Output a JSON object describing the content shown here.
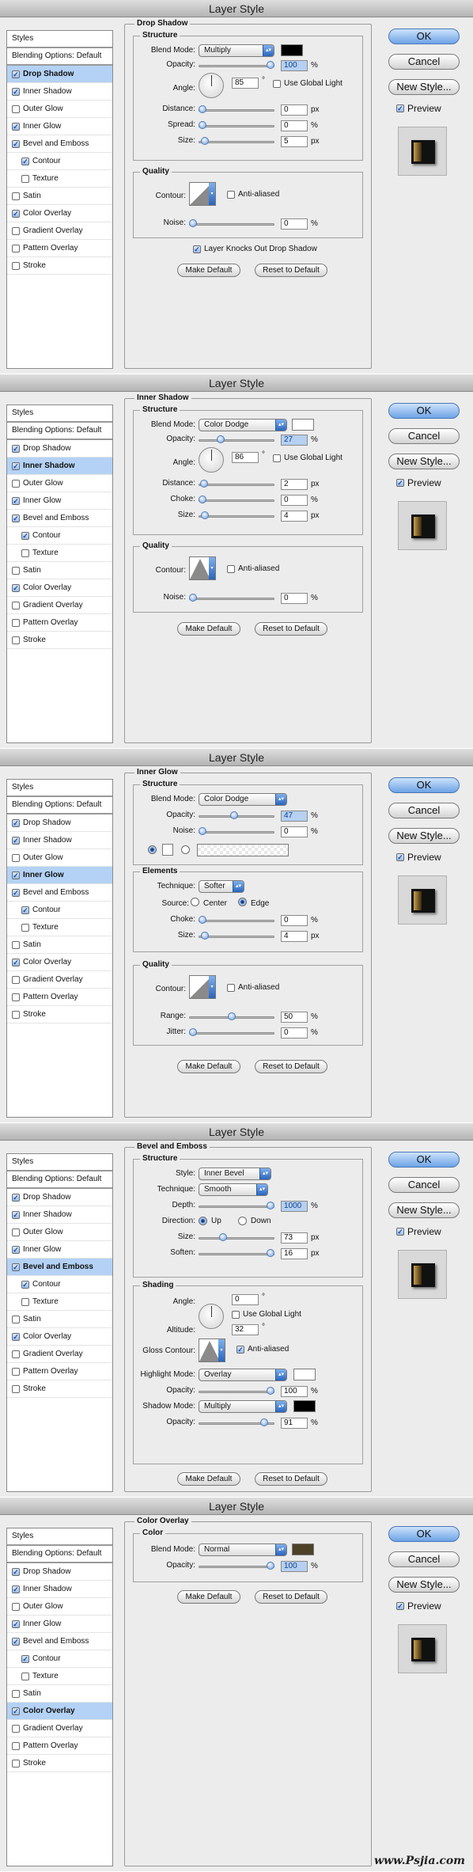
{
  "dialog_title": "Layer Style",
  "sidebar": {
    "header": "Styles",
    "blending": "Blending Options: Default",
    "items": [
      {
        "label": "Drop Shadow",
        "checked": true,
        "sub": false
      },
      {
        "label": "Inner Shadow",
        "checked": true,
        "sub": false
      },
      {
        "label": "Outer Glow",
        "checked": false,
        "sub": false
      },
      {
        "label": "Inner Glow",
        "checked": true,
        "sub": false
      },
      {
        "label": "Bevel and Emboss",
        "checked": true,
        "sub": false
      },
      {
        "label": "Contour",
        "checked": true,
        "sub": true
      },
      {
        "label": "Texture",
        "checked": false,
        "sub": true
      },
      {
        "label": "Satin",
        "checked": false,
        "sub": false
      },
      {
        "label": "Color Overlay",
        "checked": true,
        "sub": false
      },
      {
        "label": "Gradient Overlay",
        "checked": false,
        "sub": false
      },
      {
        "label": "Pattern Overlay",
        "checked": false,
        "sub": false
      },
      {
        "label": "Stroke",
        "checked": false,
        "sub": false
      }
    ]
  },
  "right": {
    "ok": "OK",
    "cancel": "Cancel",
    "new_style": "New Style...",
    "preview": "Preview"
  },
  "common": {
    "structure": "Structure",
    "quality": "Quality",
    "elements": "Elements",
    "shading": "Shading",
    "blend_mode": "Blend Mode:",
    "opacity": "Opacity:",
    "angle": "Angle:",
    "use_global_light": "Use Global Light",
    "distance": "Distance:",
    "spread": "Spread:",
    "size": "Size:",
    "choke": "Choke:",
    "contour": "Contour:",
    "anti_aliased": "Anti-aliased",
    "noise": "Noise:",
    "range": "Range:",
    "jitter": "Jitter:",
    "technique": "Technique:",
    "source": "Source:",
    "center": "Center",
    "edge": "Edge",
    "style": "Style:",
    "depth": "Depth:",
    "direction": "Direction:",
    "up": "Up",
    "down": "Down",
    "soften": "Soften:",
    "altitude": "Altitude:",
    "gloss_contour": "Gloss Contour:",
    "highlight_mode": "Highlight Mode:",
    "shadow_mode": "Shadow Mode:",
    "color": "Color",
    "make_default": "Make Default",
    "reset_default": "Reset to Default",
    "pct": "%",
    "px": "px",
    "deg": "°"
  },
  "panels": [
    {
      "title": "Drop Shadow",
      "selected": "Drop Shadow",
      "blend_mode": "Multiply",
      "color": "#000000",
      "opacity": "100",
      "angle": "85",
      "distance": "0",
      "spread": "0",
      "size": "5",
      "noise": "0",
      "knocks_out": "Layer Knocks Out Drop Shadow"
    },
    {
      "title": "Inner Shadow",
      "selected": "Inner Shadow",
      "blend_mode": "Color Dodge",
      "color": "#ffffff",
      "opacity": "27",
      "angle": "86",
      "distance": "2",
      "choke": "0",
      "size": "4",
      "noise": "0"
    },
    {
      "title": "Inner Glow",
      "selected": "Inner Glow",
      "blend_mode": "Color Dodge",
      "opacity": "47",
      "noise": "0",
      "technique": "Softer",
      "source": "Edge",
      "choke": "0",
      "size": "4",
      "range": "50",
      "jitter": "0"
    },
    {
      "title": "Bevel and Emboss",
      "selected": "Bevel and Emboss",
      "style": "Inner Bevel",
      "technique": "Smooth",
      "depth": "1000",
      "direction": "Up",
      "size": "73",
      "soften": "16",
      "angle": "0",
      "altitude": "32",
      "highlight_mode": "Overlay",
      "highlight_color": "#ffffff",
      "highlight_opacity": "100",
      "shadow_mode": "Multiply",
      "shadow_color": "#000000",
      "shadow_opacity": "91"
    },
    {
      "title": "Color Overlay",
      "selected": "Color Overlay",
      "blend_mode": "Normal",
      "color": "#4d4128",
      "opacity": "100"
    }
  ],
  "watermark": "www.Psjia.com"
}
